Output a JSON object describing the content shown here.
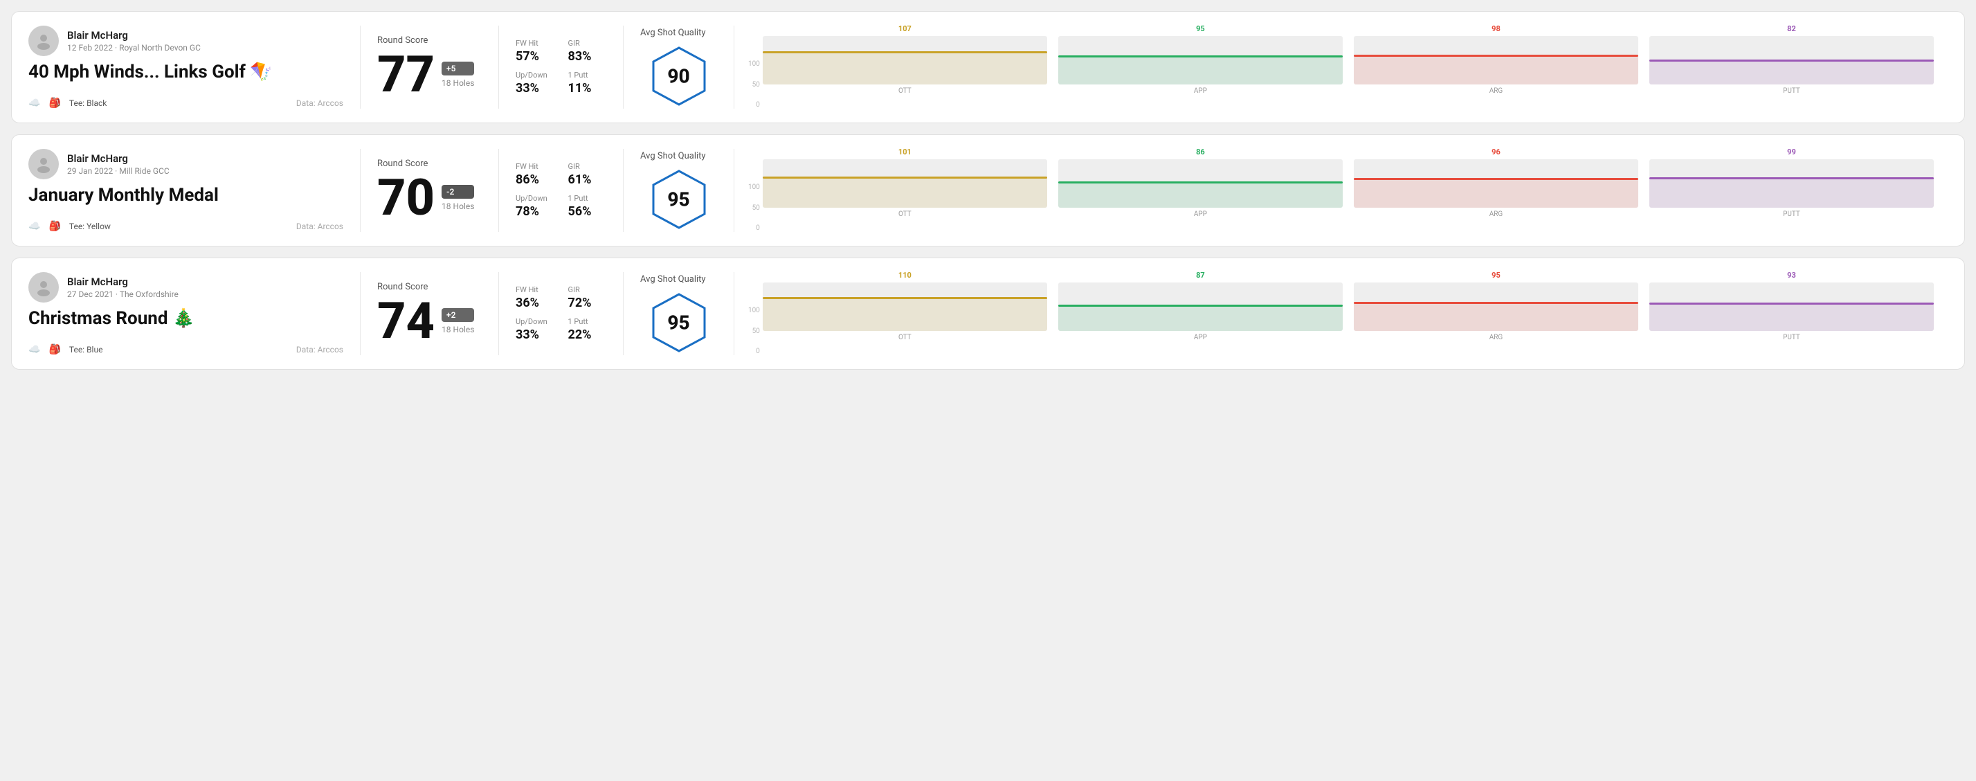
{
  "rounds": [
    {
      "id": "round1",
      "user_name": "Blair McHarg",
      "user_meta": "12 Feb 2022 · Royal North Devon GC",
      "title": "40 Mph Winds... Links Golf 🪁",
      "tee": "Tee: Black",
      "data_source": "Data: Arccos",
      "score": "77",
      "score_diff": "+5",
      "score_diff_type": "positive",
      "holes": "18 Holes",
      "fw_hit": "57%",
      "gir": "83%",
      "up_down": "33%",
      "one_putt": "11%",
      "avg_shot_quality": "90",
      "chart": {
        "ott": {
          "value": 107,
          "color": "#c9a227",
          "bar_pct": 68
        },
        "app": {
          "value": 95,
          "color": "#27ae60",
          "bar_pct": 60
        },
        "arg": {
          "value": 98,
          "color": "#e74c3c",
          "bar_pct": 62
        },
        "putt": {
          "value": 82,
          "color": "#9b59b6",
          "bar_pct": 52
        }
      }
    },
    {
      "id": "round2",
      "user_name": "Blair McHarg",
      "user_meta": "29 Jan 2022 · Mill Ride GCC",
      "title": "January Monthly Medal",
      "tee": "Tee: Yellow",
      "data_source": "Data: Arccos",
      "score": "70",
      "score_diff": "-2",
      "score_diff_type": "negative",
      "holes": "18 Holes",
      "fw_hit": "86%",
      "gir": "61%",
      "up_down": "78%",
      "one_putt": "56%",
      "avg_shot_quality": "95",
      "chart": {
        "ott": {
          "value": 101,
          "color": "#c9a227",
          "bar_pct": 65
        },
        "app": {
          "value": 86,
          "color": "#27ae60",
          "bar_pct": 55
        },
        "arg": {
          "value": 96,
          "color": "#e74c3c",
          "bar_pct": 61
        },
        "putt": {
          "value": 99,
          "color": "#9b59b6",
          "bar_pct": 63
        }
      }
    },
    {
      "id": "round3",
      "user_name": "Blair McHarg",
      "user_meta": "27 Dec 2021 · The Oxfordshire",
      "title": "Christmas Round 🎄",
      "tee": "Tee: Blue",
      "data_source": "Data: Arccos",
      "score": "74",
      "score_diff": "+2",
      "score_diff_type": "positive",
      "holes": "18 Holes",
      "fw_hit": "36%",
      "gir": "72%",
      "up_down": "33%",
      "one_putt": "22%",
      "avg_shot_quality": "95",
      "chart": {
        "ott": {
          "value": 110,
          "color": "#c9a227",
          "bar_pct": 70
        },
        "app": {
          "value": 87,
          "color": "#27ae60",
          "bar_pct": 55
        },
        "arg": {
          "value": 95,
          "color": "#e74c3c",
          "bar_pct": 60
        },
        "putt": {
          "value": 93,
          "color": "#9b59b6",
          "bar_pct": 59
        }
      }
    }
  ],
  "labels": {
    "round_score": "Round Score",
    "avg_shot_quality": "Avg Shot Quality",
    "fw_hit": "FW Hit",
    "gir": "GIR",
    "up_down": "Up/Down",
    "one_putt": "1 Putt",
    "ott": "OTT",
    "app": "APP",
    "arg": "ARG",
    "putt": "PUTT",
    "y100": "100",
    "y50": "50",
    "y0": "0"
  }
}
